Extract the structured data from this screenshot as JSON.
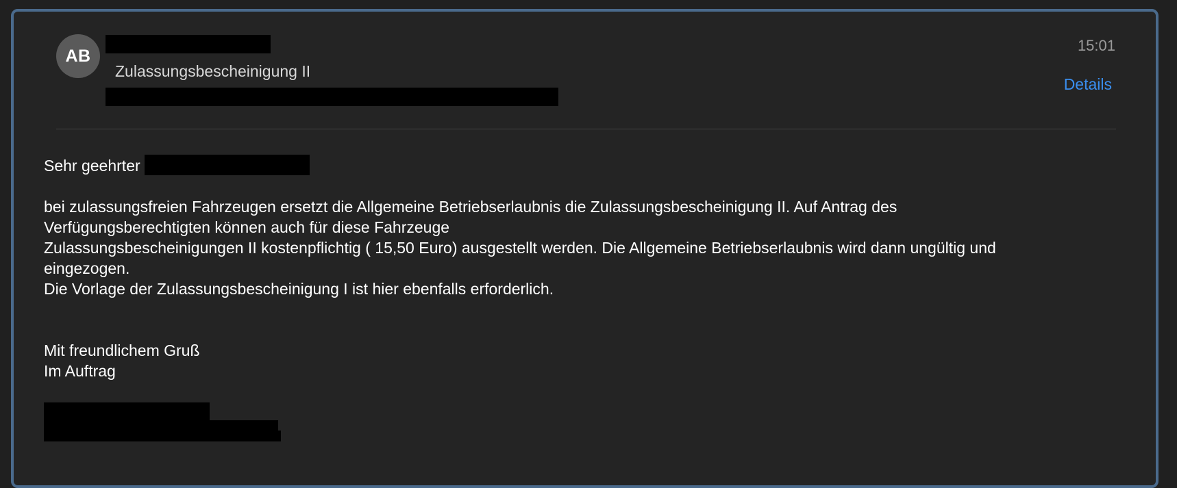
{
  "header": {
    "avatar_initials": "AB",
    "subject": "Zulassungsbescheinigung II",
    "time": "15:01",
    "details_label": "Details"
  },
  "message": {
    "greeting": "Sehr geehrter",
    "para1_line1": "bei zulassungsfreien Fahrzeugen ersetzt die Allgemeine Betriebserlaubnis die Zulassungsbescheinigung II. Auf Antrag des",
    "para1_line2": "Verfügungsberechtigten können auch für diese Fahrzeuge",
    "para1_line3": "Zulassungsbescheinigungen II kostenpflichtig ( 15,50 Euro) ausgestellt werden. Die Allgemeine Betriebserlaubnis wird dann ungültig und",
    "para1_line4": "eingezogen.",
    "para1_line5": "Die Vorlage der Zulassungsbescheinigung I ist hier ebenfalls erforderlich.",
    "closing_line1": "Mit freundlichem Gruß",
    "closing_line2": "Im Auftrag"
  },
  "colors": {
    "background": "#242424",
    "border": "#4a6a8c",
    "link": "#3a8ff0",
    "text": "#ffffff",
    "muted": "#9a9a9a"
  }
}
